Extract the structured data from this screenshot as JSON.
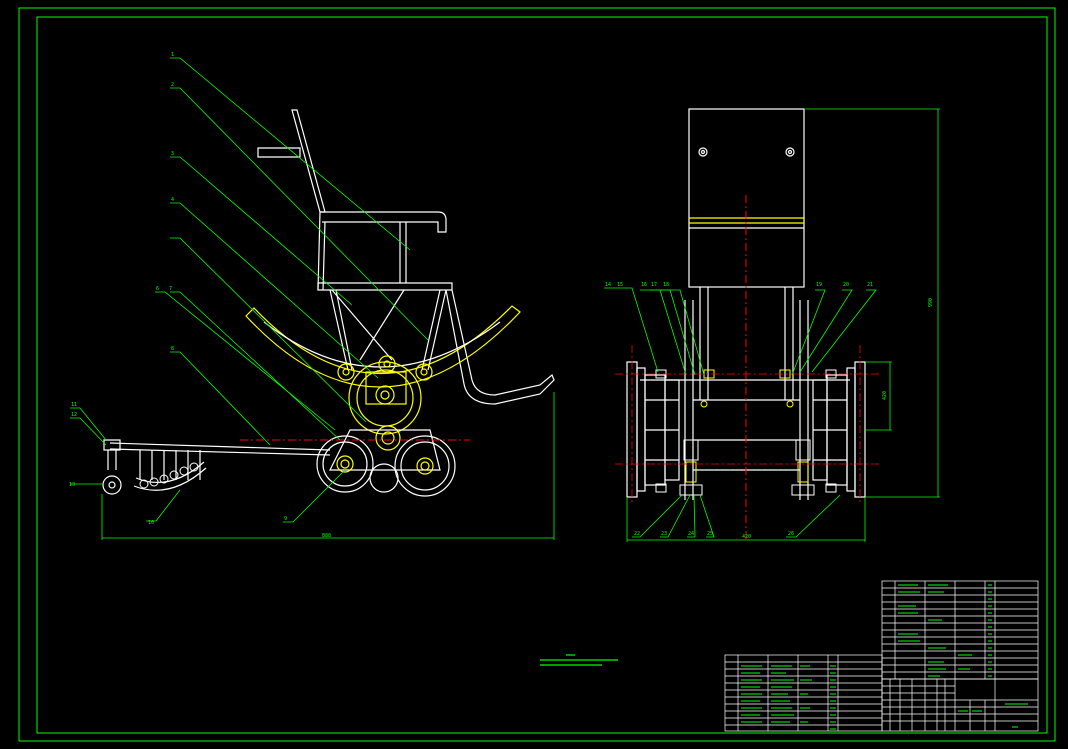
{
  "colors": {
    "frame": "#00ff00",
    "outline": "#ffffff",
    "mechanism": "#ffff00",
    "centerline": "#ff0000",
    "background": "#000000"
  },
  "leaders": {
    "l1": "1",
    "l2": "2",
    "l3": "3",
    "l4": "4",
    "l6": "6",
    "l7": "7",
    "l8": "8",
    "l9": "9",
    "l11": "11",
    "l12": "12",
    "l13": "13",
    "l10": "10",
    "r14": "14",
    "r15": "15",
    "r16": "16",
    "r17": "17",
    "r18": "18",
    "r19": "19",
    "r20": "20",
    "r21": "21",
    "r22": "22",
    "r23": "23",
    "r24": "24",
    "r25": "25",
    "r26": "26"
  },
  "dimensions": {
    "overall_length": "888",
    "overall_width": "420",
    "overall_height": "990",
    "wheel_span": "420",
    "left_offset": "35",
    "right_offset": "35",
    "mid_a": "40",
    "mid_b": "80"
  }
}
